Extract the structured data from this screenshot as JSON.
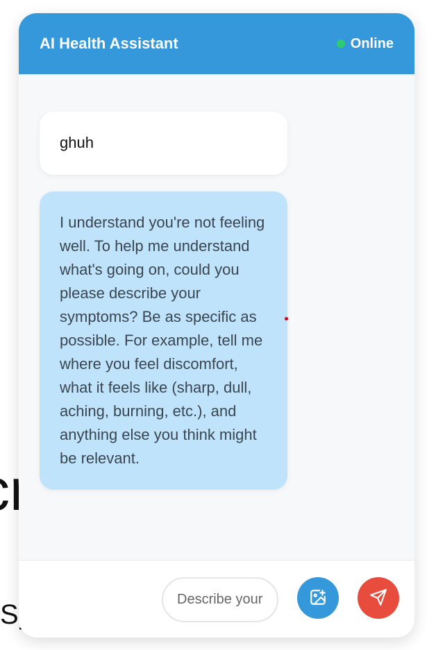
{
  "background": {
    "large_fragment": "cr",
    "small_fragment": "Sy"
  },
  "header": {
    "title": "AI Health Assistant",
    "status_label": "Online",
    "status_color": "#2ecc71"
  },
  "messages": [
    {
      "role": "user",
      "text": "ghuh"
    },
    {
      "role": "assistant",
      "text": "I understand you're not feeling well. To help me understand what's going on, could you please describe your symptoms? Be as specific as possible. For example, tell me where you feel discomfort, what it feels like (sharp, dull, aching, burning, etc.), and anything else you think might be relevant."
    }
  ],
  "composer": {
    "placeholder": "Describe your symptoms...",
    "value": ""
  },
  "icons": {
    "image_upload": "image-add-icon",
    "send": "send-icon"
  },
  "colors": {
    "header": "#3498db",
    "user_bubble": "#ffffff",
    "assistant_bubble": "#bfe3fb",
    "image_button": "#3498db",
    "send_button": "#e74c3c"
  }
}
